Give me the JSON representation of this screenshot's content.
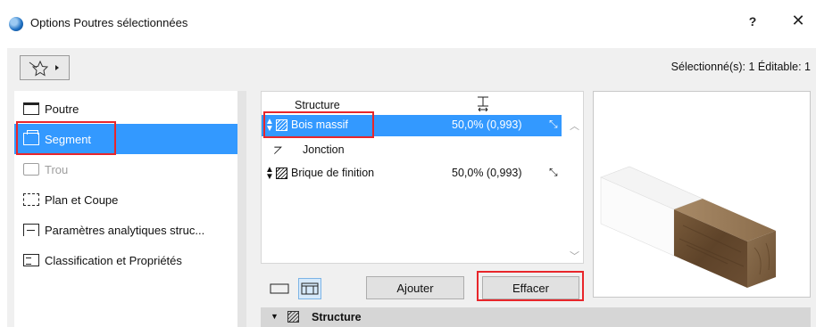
{
  "window": {
    "title": "Options Poutres sélectionnées",
    "help_label": "?",
    "close_label": "✕"
  },
  "toolbar": {
    "selected_info": "Sélectionné(s): 1 Éditable: 1"
  },
  "sidebar": {
    "items": [
      {
        "label": "Poutre",
        "icon": "beam-icon"
      },
      {
        "label": "Segment",
        "icon": "segment-icon",
        "active": true
      },
      {
        "label": "Trou",
        "icon": "hole-icon",
        "disabled": true
      },
      {
        "label": "Plan et Coupe",
        "icon": "plan-section-icon"
      },
      {
        "label": "Paramètres analytiques struc...",
        "icon": "analytical-icon"
      },
      {
        "label": "Classification et Propriétés",
        "icon": "classification-icon"
      }
    ]
  },
  "structure_list": {
    "header_label": "Structure",
    "rows": [
      {
        "name": "Bois massif",
        "percent": "50,0% (0,993)",
        "selected": true
      },
      {
        "name": "Jonction",
        "kind": "joint"
      },
      {
        "name": "Brique de finition",
        "percent": "50,0% (0,993)"
      }
    ]
  },
  "buttons": {
    "add_label": "Ajouter",
    "delete_label": "Effacer"
  },
  "section": {
    "structure_label": "Structure"
  },
  "colors": {
    "selection": "#3399ff",
    "highlight_box": "#e8262b",
    "dialog_bg": "#f0f0f0"
  }
}
